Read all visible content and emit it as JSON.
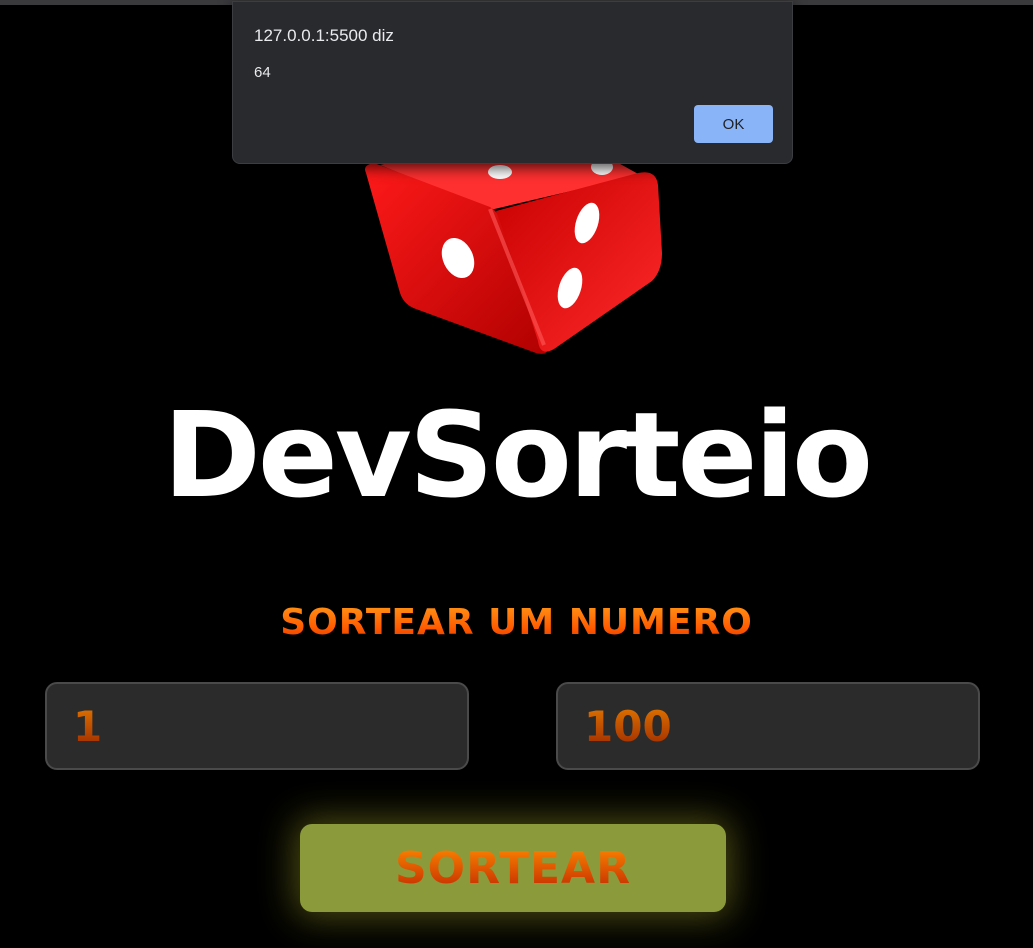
{
  "alert": {
    "origin": "127.0.0.1:5500 diz",
    "message": "64",
    "ok_label": "OK",
    "button_color": "#8ab4f8"
  },
  "logo": {
    "title": "DevSorteio",
    "icon": "dice-icon",
    "dice_color": "#e00000"
  },
  "heading": "SORTEAR UM NUMERO",
  "inputs": {
    "min_value": "1",
    "max_value": "100"
  },
  "draw_button": {
    "label": "SORTEAR",
    "color": "#8b9a3a"
  },
  "accent_color": "#ff6a00"
}
